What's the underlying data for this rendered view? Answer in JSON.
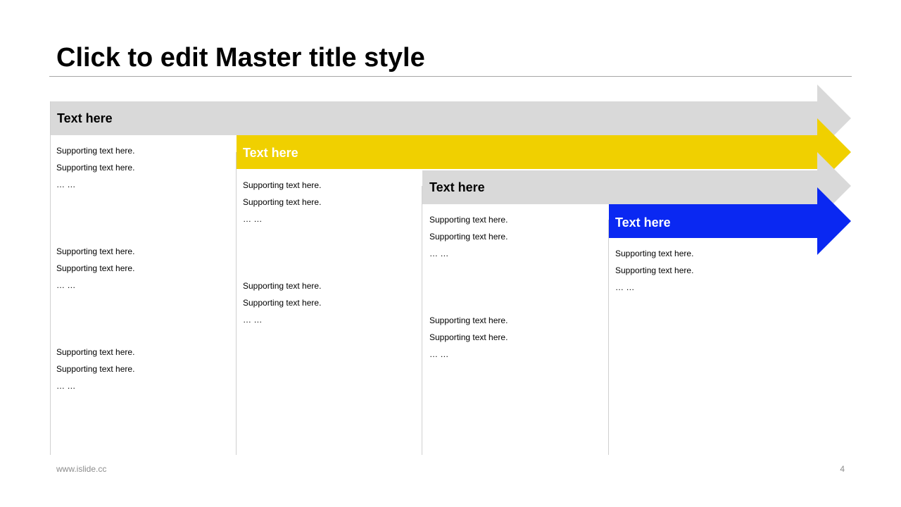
{
  "slide": {
    "title": "Click to edit Master title style",
    "footer_url": "www.islide.cc",
    "page_number": "4"
  },
  "colors": {
    "gray_arrow": "#d9d9d9",
    "yellow_arrow": "#f0d000",
    "blue_arrow": "#0a28f2",
    "divider": "#d0d0d0"
  },
  "stages": [
    {
      "label": "Text here",
      "color_name": "gray",
      "blocks": [
        [
          "Supporting text here.",
          "Supporting text here.",
          "… …"
        ],
        [
          "Supporting text here.",
          "Supporting text here.",
          "… …"
        ],
        [
          "Supporting text here.",
          "Supporting text here.",
          "… …"
        ]
      ]
    },
    {
      "label": "Text here",
      "color_name": "yellow",
      "blocks": [
        [
          "Supporting text here.",
          "Supporting text here.",
          "… …"
        ],
        [
          "Supporting text here.",
          "Supporting text here.",
          "… …"
        ]
      ]
    },
    {
      "label": "Text here",
      "color_name": "gray",
      "blocks": [
        [
          "Supporting text here.",
          "Supporting text here.",
          "… …"
        ],
        [
          "Supporting text here.",
          "Supporting text here.",
          "… …"
        ]
      ]
    },
    {
      "label": "Text here",
      "color_name": "blue",
      "blocks": [
        [
          "Supporting text here.",
          "Supporting text here.",
          "… …"
        ]
      ]
    }
  ]
}
